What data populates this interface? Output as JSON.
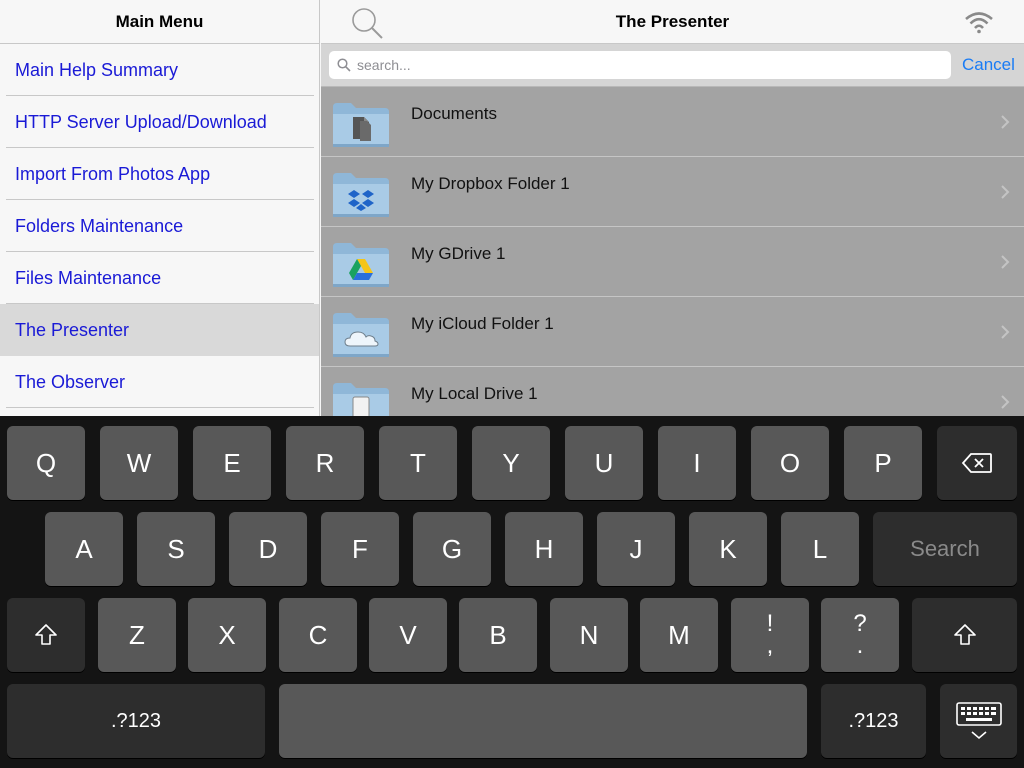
{
  "left_pane": {
    "title": "Main Menu",
    "items": [
      {
        "label": "Main Help Summary"
      },
      {
        "label": "HTTP Server Upload/Download"
      },
      {
        "label": "Import From Photos App"
      },
      {
        "label": "Folders Maintenance"
      },
      {
        "label": "Files Maintenance"
      },
      {
        "label": "The Presenter",
        "selected": true
      },
      {
        "label": "The Observer"
      }
    ]
  },
  "right_pane": {
    "title": "The Presenter",
    "search": {
      "placeholder": "search...",
      "value": "",
      "cancel_label": "Cancel"
    },
    "files": [
      {
        "name": "Documents",
        "icon": "documents-folder-icon"
      },
      {
        "name": "My Dropbox Folder 1",
        "icon": "dropbox-folder-icon"
      },
      {
        "name": "My GDrive 1",
        "icon": "gdrive-folder-icon"
      },
      {
        "name": "My iCloud Folder 1",
        "icon": "icloud-folder-icon"
      },
      {
        "name": "My Local Drive 1",
        "icon": "local-drive-folder-icon"
      }
    ]
  },
  "keyboard": {
    "row1": [
      "Q",
      "W",
      "E",
      "R",
      "T",
      "Y",
      "U",
      "I",
      "O",
      "P"
    ],
    "row2": [
      "A",
      "S",
      "D",
      "F",
      "G",
      "H",
      "J",
      "K",
      "L"
    ],
    "row3": [
      "Z",
      "X",
      "C",
      "V",
      "B",
      "N",
      "M"
    ],
    "search_label": "Search",
    "numbers_label": ".?123",
    "punct1": [
      "!",
      ","
    ],
    "punct2": [
      "?",
      "."
    ]
  },
  "colors": {
    "menu_link": "#1a1ad6",
    "accent": "#1a7cf5",
    "keyboard_bg": "#141414",
    "key": "#585858"
  }
}
